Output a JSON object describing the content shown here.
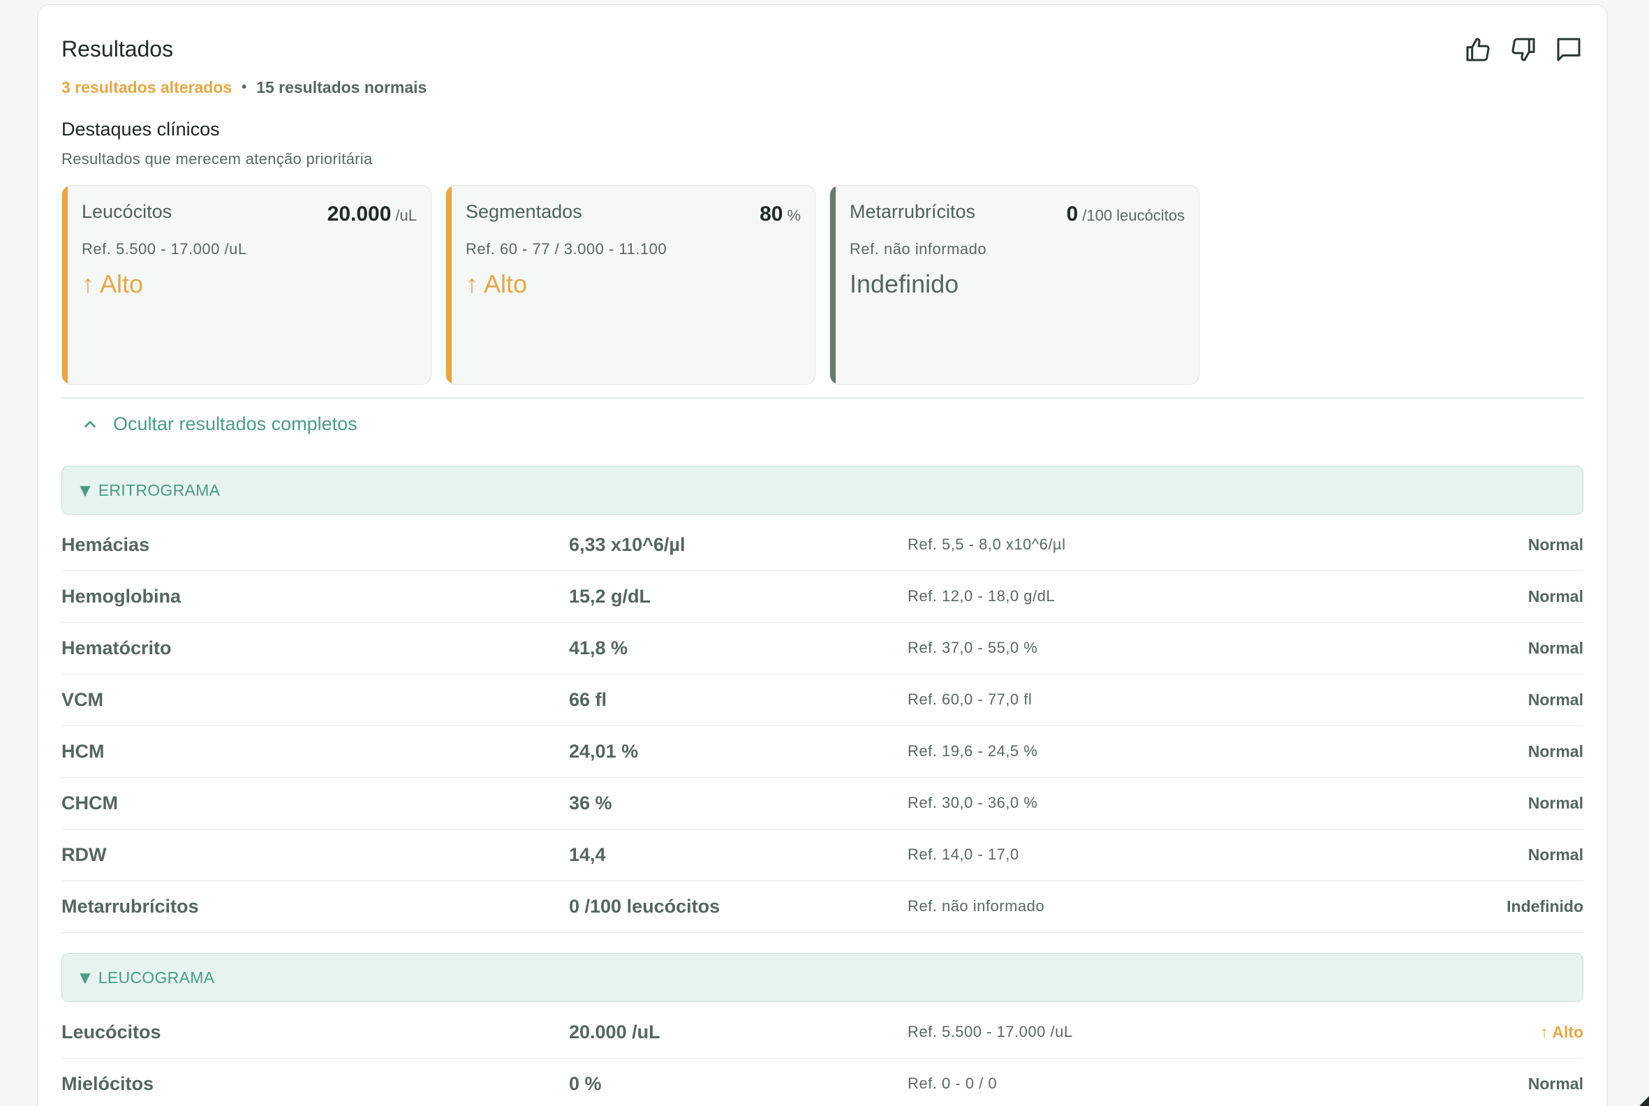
{
  "header": {
    "title": "Resultados"
  },
  "summary": {
    "altered": "3 resultados alterados",
    "sep": "•",
    "normal": "15 resultados normais"
  },
  "highlights": {
    "title": "Destaques clínicos",
    "subtitle": "Resultados que merecem atenção prioritária",
    "cards": [
      {
        "name": "Leucócitos",
        "value": "20.000",
        "unit": "/uL",
        "ref": "Ref. 5.500 - 17.000 /uL",
        "status": "↑ Alto"
      },
      {
        "name": "Segmentados",
        "value": "80",
        "unit": "%",
        "ref": "Ref. 60 - 77 / 3.000 - 11.100",
        "status": "↑ Alto"
      },
      {
        "name": "Metarrubrícitos",
        "value": "0",
        "unit": "/100 leucócitos",
        "ref": "Ref. não informado",
        "status": "Indefinido"
      }
    ]
  },
  "toggle": {
    "label": "Ocultar resultados completos"
  },
  "sections": {
    "eritrograma": {
      "label": "ERITROGRAMA",
      "rows": [
        {
          "name": "Hemácias",
          "value": "6,33 x10^6/µl",
          "ref": "Ref. 5,5 - 8,0 x10^6/µl",
          "status": "Normal"
        },
        {
          "name": "Hemoglobina",
          "value": "15,2 g/dL",
          "ref": "Ref. 12,0 - 18,0 g/dL",
          "status": "Normal"
        },
        {
          "name": "Hematócrito",
          "value": "41,8 %",
          "ref": "Ref. 37,0 - 55,0 %",
          "status": "Normal"
        },
        {
          "name": "VCM",
          "value": "66 fl",
          "ref": "Ref. 60,0 - 77,0 fl",
          "status": "Normal"
        },
        {
          "name": "HCM",
          "value": "24,01 %",
          "ref": "Ref. 19,6 - 24,5 %",
          "status": "Normal"
        },
        {
          "name": "CHCM",
          "value": "36 %",
          "ref": "Ref. 30,0 - 36,0 %",
          "status": "Normal"
        },
        {
          "name": "RDW",
          "value": "14,4",
          "ref": "Ref. 14,0 - 17,0",
          "status": "Normal"
        },
        {
          "name": "Metarrubrícitos",
          "value": "0 /100 leucócitos",
          "ref": "Ref. não informado",
          "status": "Indefinido"
        }
      ]
    },
    "leucograma": {
      "label": "LEUCOGRAMA",
      "rows": [
        {
          "name": "Leucócitos",
          "value": "20.000 /uL",
          "ref": "Ref. 5.500 - 17.000 /uL",
          "status": "↑ Alto"
        },
        {
          "name": "Mielócitos",
          "value": "0 %",
          "ref": "Ref. 0 - 0 / 0",
          "status": "Normal"
        }
      ]
    }
  },
  "colors": {
    "alert": "#e2a847",
    "accent": "#4b9a86",
    "neutral": "#55655f"
  },
  "icons": [
    "thumbs-up-icon",
    "thumbs-down-icon",
    "comment-icon",
    "chevron-up-icon",
    "triangle-down-icon"
  ]
}
